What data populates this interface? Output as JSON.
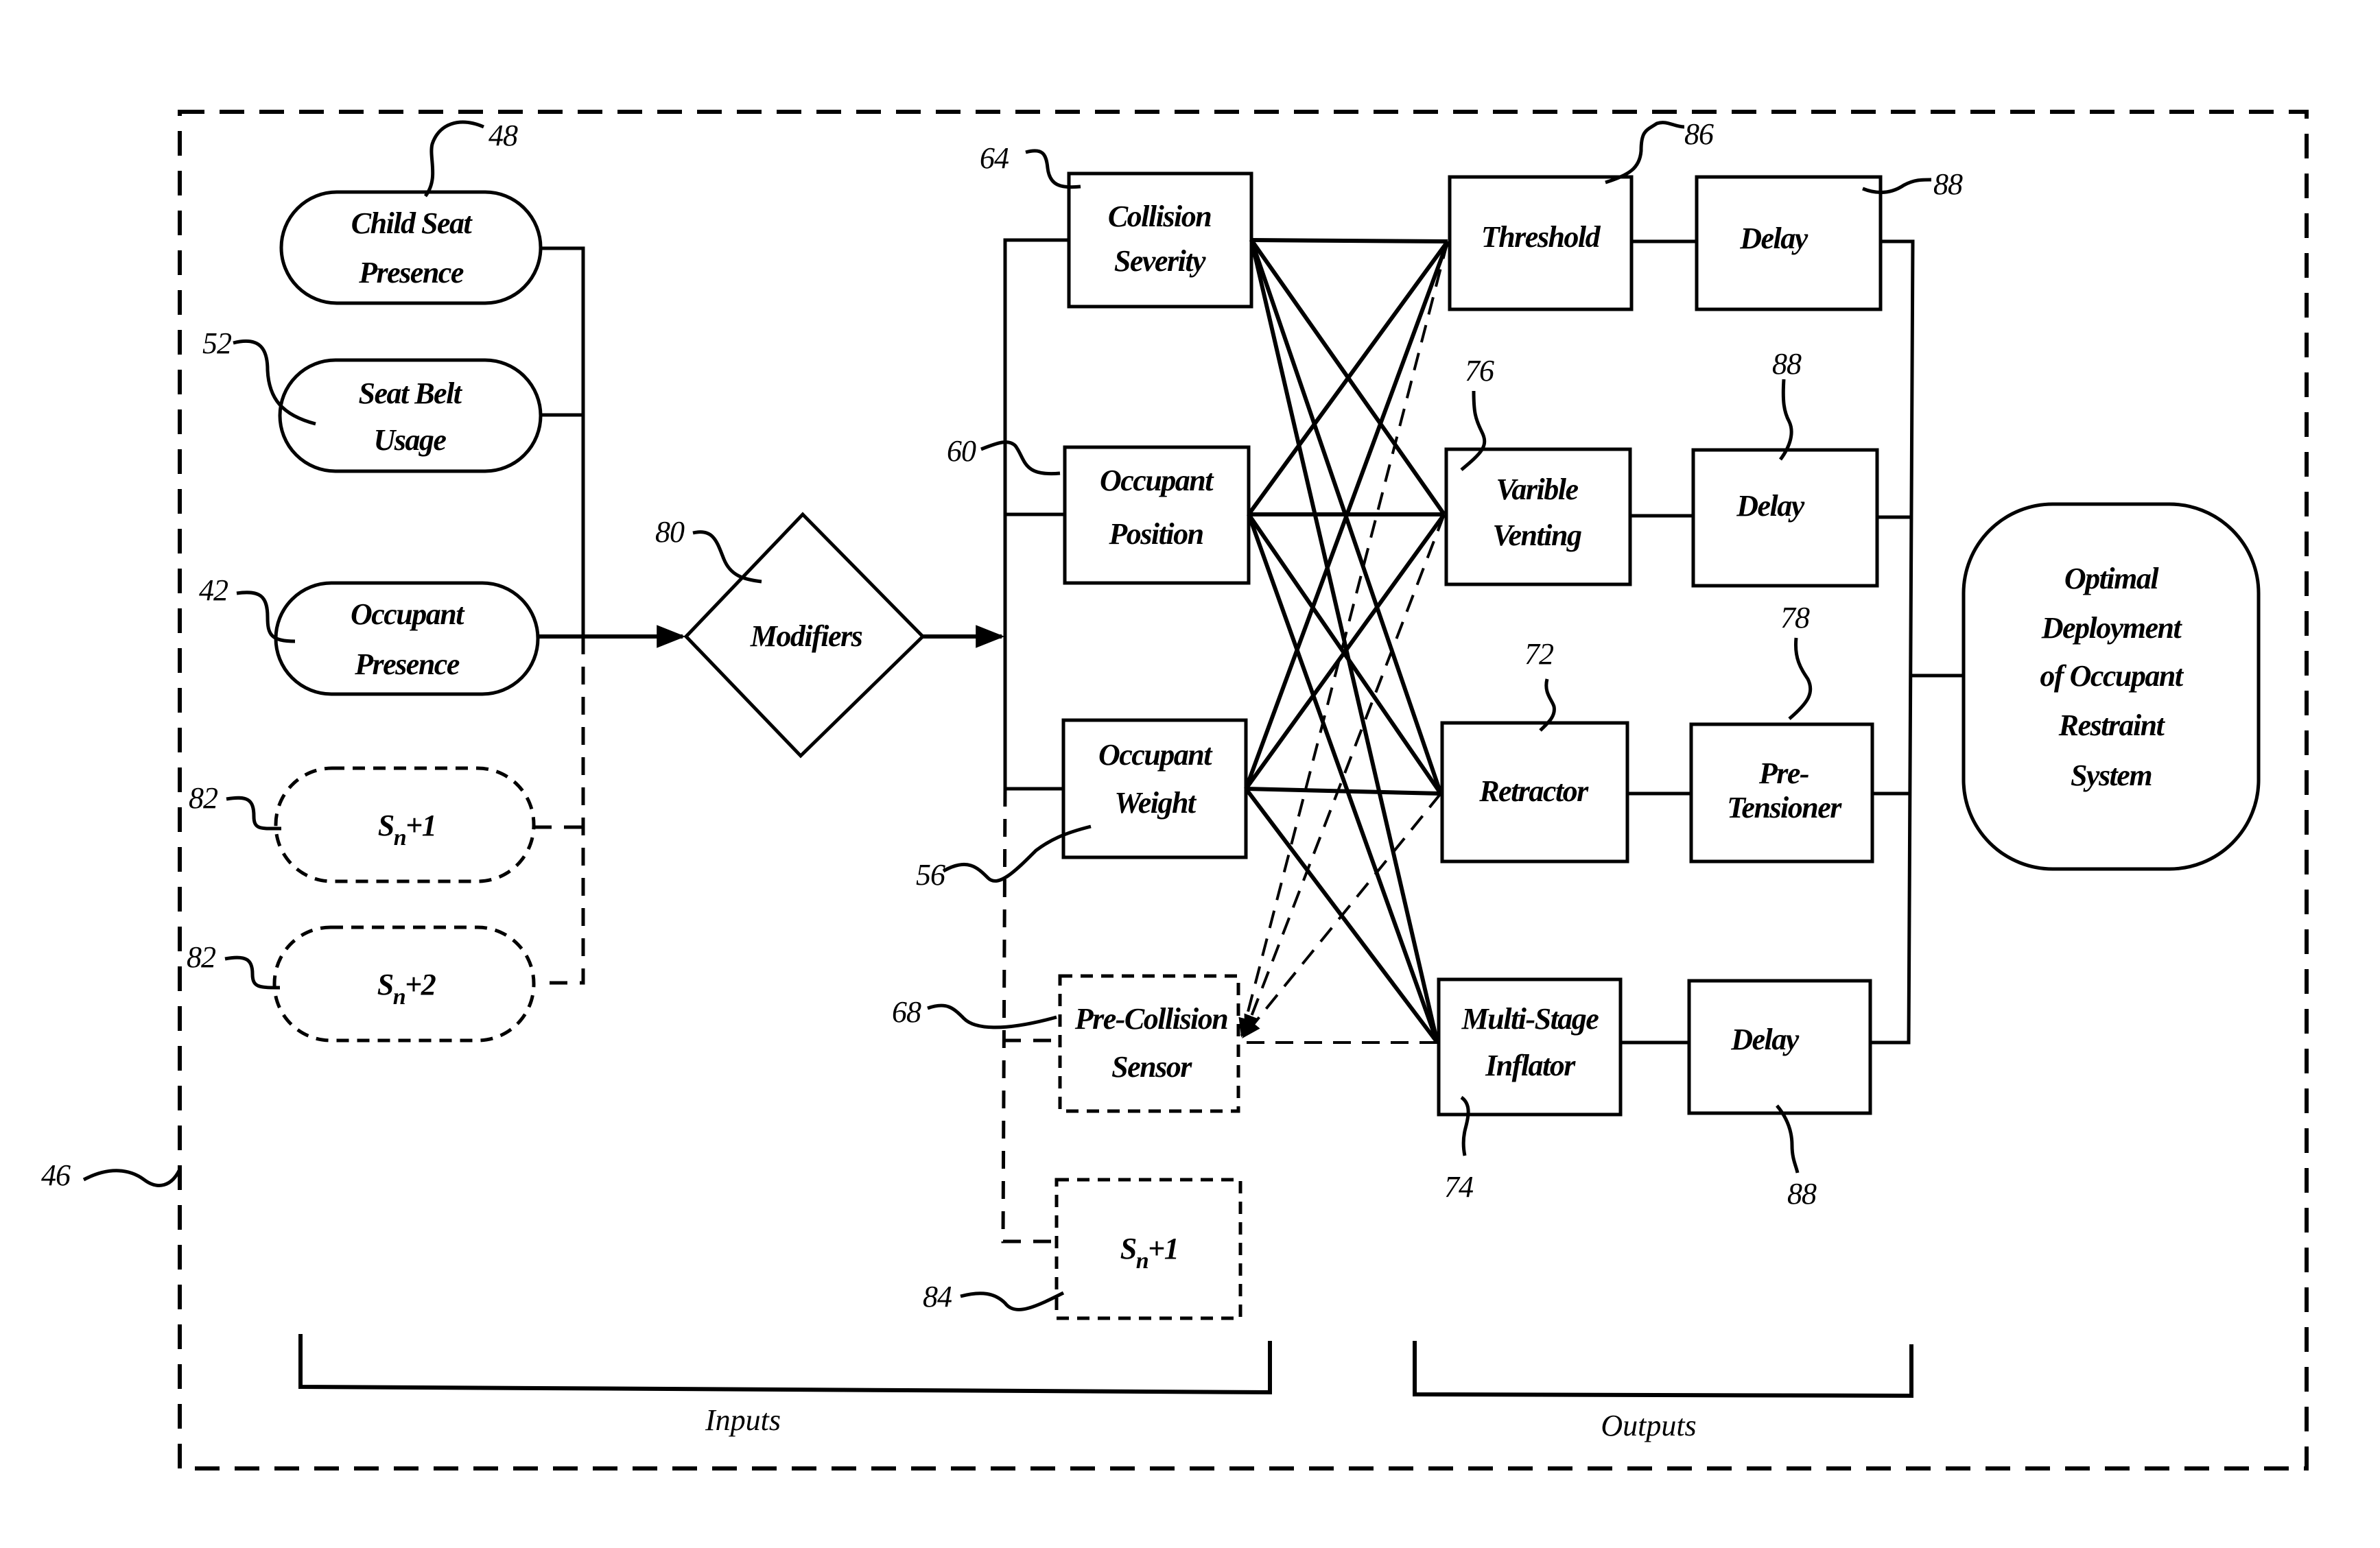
{
  "figure": {
    "system_ref": "46",
    "groups": {
      "inputs_label": "Inputs",
      "outputs_label": "Outputs"
    },
    "sensors": [
      {
        "id": "child-seat-presence",
        "lines": [
          "Child Seat",
          "Presence"
        ],
        "ref": "48",
        "style": "solid"
      },
      {
        "id": "seat-belt-usage",
        "lines": [
          "Seat Belt",
          "Usage"
        ],
        "ref": "52",
        "style": "solid"
      },
      {
        "id": "occupant-presence",
        "lines": [
          "Occupant",
          "Presence"
        ],
        "ref": "42",
        "style": "solid"
      },
      {
        "id": "sensor-sn-plus-1",
        "main": "S",
        "sub": "n",
        "suffix": "+1",
        "ref": "82",
        "style": "dashed"
      },
      {
        "id": "sensor-sn-plus-2",
        "main": "S",
        "sub": "n",
        "suffix": "+2",
        "ref": "82",
        "style": "dashed"
      }
    ],
    "modifiers": {
      "label": "Modifiers",
      "ref": "80"
    },
    "inputs": [
      {
        "id": "collision-severity",
        "lines": [
          "Collision",
          "Severity"
        ],
        "ref": "64",
        "style": "solid"
      },
      {
        "id": "occupant-position",
        "lines": [
          "Occupant",
          "Position"
        ],
        "ref": "60",
        "style": "solid"
      },
      {
        "id": "occupant-weight",
        "lines": [
          "Occupant",
          "Weight"
        ],
        "ref": "56",
        "style": "solid"
      },
      {
        "id": "pre-collision-sensor",
        "lines": [
          "Pre-Collision",
          "Sensor"
        ],
        "ref": "68",
        "style": "dashed"
      },
      {
        "id": "input-sn-plus-1",
        "main": "S",
        "sub": "n",
        "suffix": "+1",
        "ref": "84",
        "style": "dashed"
      }
    ],
    "outputs": [
      {
        "id": "threshold",
        "lines": [
          "Threshold"
        ],
        "ref": "86"
      },
      {
        "id": "varible-venting",
        "lines": [
          "Varible",
          "Venting"
        ],
        "ref": "76"
      },
      {
        "id": "retractor",
        "lines": [
          "Retractor"
        ],
        "ref": "72"
      },
      {
        "id": "multi-stage-inflator",
        "lines": [
          "Multi-Stage",
          "Inflator"
        ],
        "ref": "74"
      }
    ],
    "stage2": [
      {
        "id": "delay-1",
        "lines": [
          "Delay"
        ],
        "ref": "88"
      },
      {
        "id": "delay-2",
        "lines": [
          "Delay"
        ],
        "ref": "88"
      },
      {
        "id": "pre-tensioner",
        "lines": [
          "Pre-",
          "Tensioner"
        ],
        "ref": "78"
      },
      {
        "id": "delay-3",
        "lines": [
          "Delay"
        ],
        "ref": "88"
      }
    ],
    "result": {
      "lines": [
        "Optimal",
        "Deployment",
        "of Occupant",
        "Restraint",
        "System"
      ]
    }
  }
}
